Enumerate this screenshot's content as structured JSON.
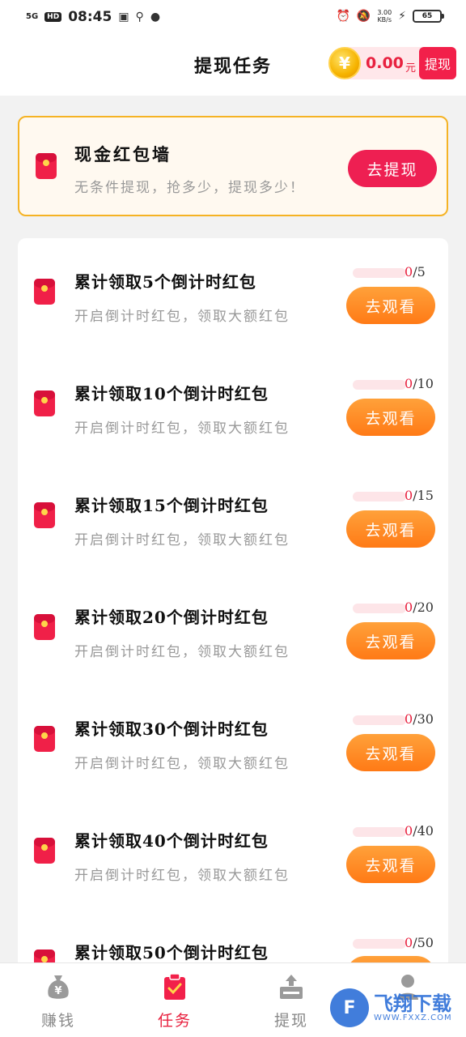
{
  "status_bar": {
    "network": "5G",
    "hd": "HD",
    "time": "08:45",
    "speed_value": "3.00",
    "speed_unit": "KB/s",
    "battery": "65"
  },
  "header": {
    "title": "提现任务",
    "coin_symbol": "¥",
    "balance": "0.00",
    "balance_unit": "元",
    "withdraw_label": "提现"
  },
  "cash_wall": {
    "title": "现金红包墙",
    "subtitle": "无条件提现，抢多少，提现多少！",
    "button": "去提现"
  },
  "tasks": [
    {
      "title": "累计领取5个倒计时红包",
      "desc": "开启倒计时红包，领取大额红包",
      "current": "0",
      "total": "/5",
      "progress": 0,
      "button": "去观看"
    },
    {
      "title": "累计领取10个倒计时红包",
      "desc": "开启倒计时红包，领取大额红包",
      "current": "0",
      "total": "/10",
      "progress": 0,
      "button": "去观看"
    },
    {
      "title": "累计领取15个倒计时红包",
      "desc": "开启倒计时红包，领取大额红包",
      "current": "0",
      "total": "/15",
      "progress": 0,
      "button": "去观看"
    },
    {
      "title": "累计领取20个倒计时红包",
      "desc": "开启倒计时红包，领取大额红包",
      "current": "0",
      "total": "/20",
      "progress": 0,
      "button": "去观看"
    },
    {
      "title": "累计领取30个倒计时红包",
      "desc": "开启倒计时红包，领取大额红包",
      "current": "0",
      "total": "/30",
      "progress": 0,
      "button": "去观看"
    },
    {
      "title": "累计领取40个倒计时红包",
      "desc": "开启倒计时红包，领取大额红包",
      "current": "0",
      "total": "/40",
      "progress": 0,
      "button": "去观看"
    },
    {
      "title": "累计领取50个倒计时红包",
      "desc": "",
      "current": "0",
      "total": "/50",
      "progress": 0,
      "button": ""
    }
  ],
  "tab_bar": {
    "tabs": [
      {
        "label": "赚钱",
        "icon": "money-bag-icon",
        "active": false
      },
      {
        "label": "任务",
        "icon": "task-clipboard-icon",
        "active": true
      },
      {
        "label": "提现",
        "icon": "withdraw-tray-icon",
        "active": false
      },
      {
        "label": "",
        "icon": "profile-icon",
        "active": false
      }
    ]
  },
  "watermark": {
    "text": "飞翔下载",
    "url": "WWW.FXXZ.COM"
  },
  "colors": {
    "accent_red": "#e8213f",
    "button_orange": "#ff8a22",
    "border_gold": "#f5b324"
  }
}
